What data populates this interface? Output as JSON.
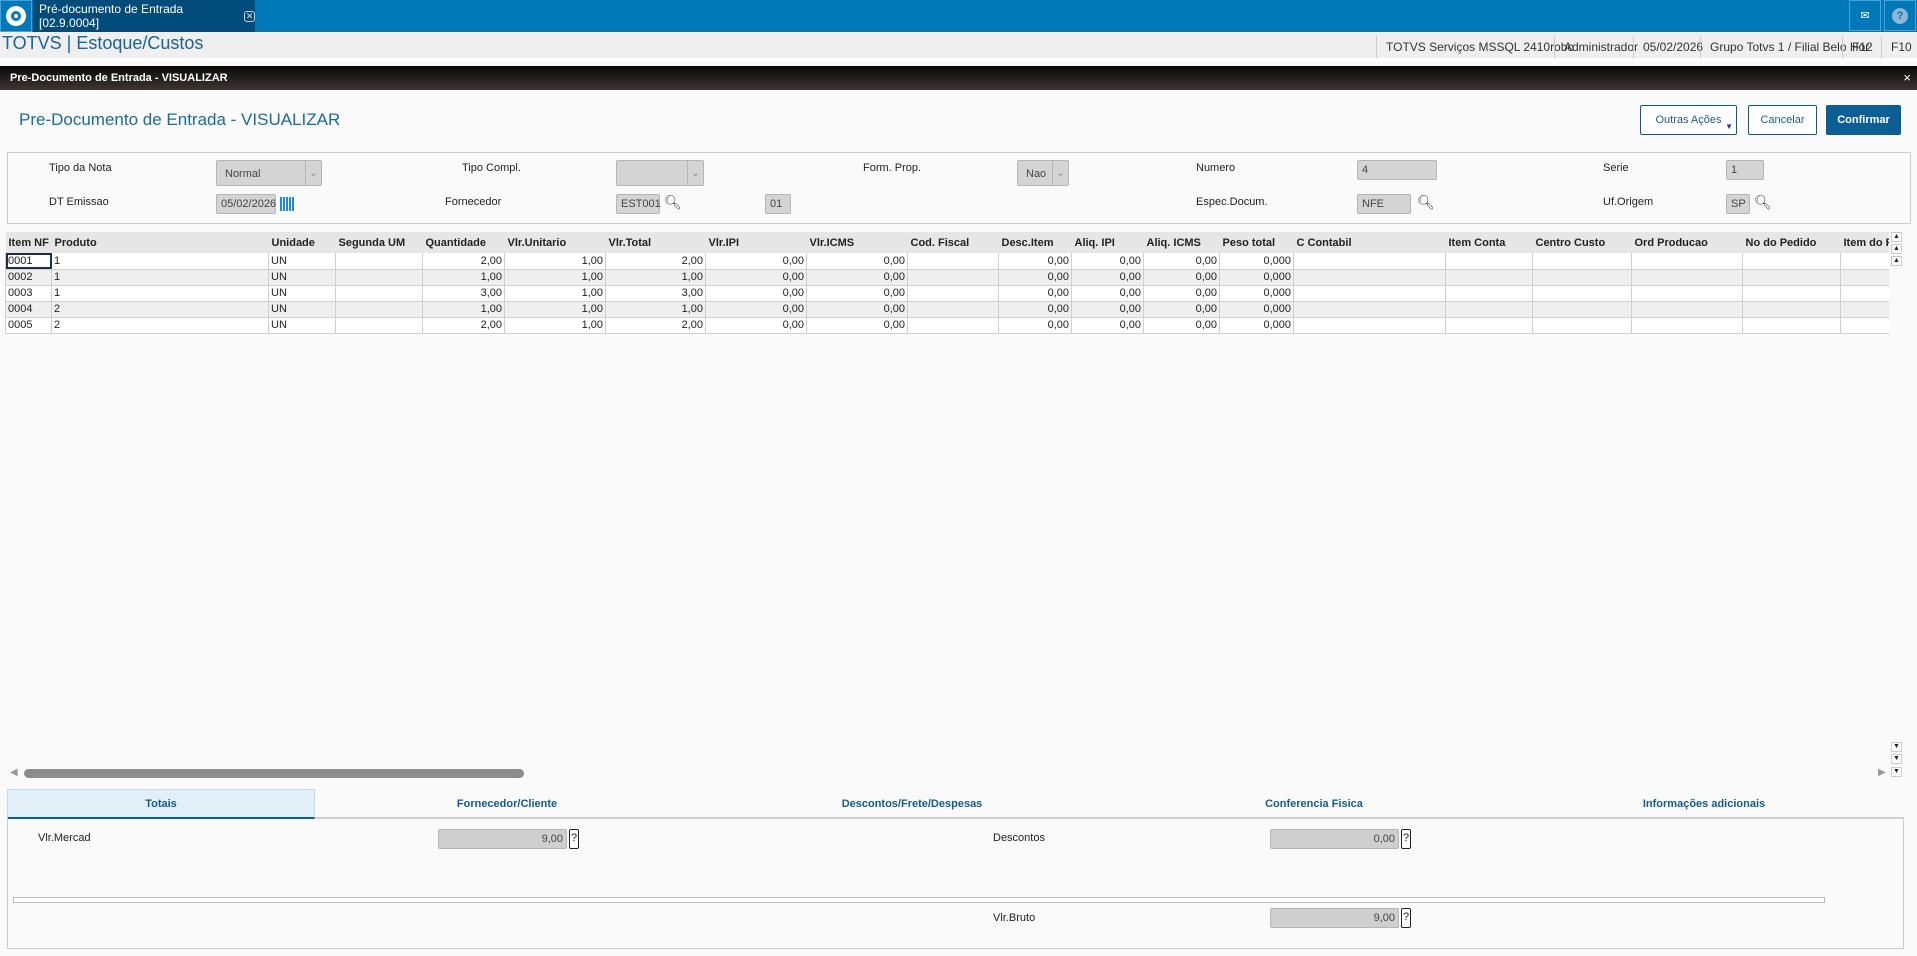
{
  "topbar": {
    "tab_label": "Pré-documento de Entrada [02.9.0004]",
    "tab_close": "✕",
    "mail_icon": "mail-icon",
    "help_icon": "help-icon",
    "accent": "#0179b9"
  },
  "appbar": {
    "title": "TOTVS | Estoque/Custos",
    "status": [
      "TOTVS Serviços MSSQL 2410robo",
      "Administrador",
      "05/02/2026",
      "Grupo Totvs 1 / Filial Belo Hor",
      "F12",
      "F10"
    ]
  },
  "dialog": {
    "bar_title": "Pre-Documento de Entrada - VISUALIZAR",
    "close": "×",
    "page_title": "Pre-Documento de Entrada - VISUALIZAR",
    "buttons": {
      "other": "Outras Ações",
      "cancel": "Cancelar",
      "confirm": "Confirmar"
    }
  },
  "form": {
    "tipo_nota": {
      "label": "Tipo da Nota",
      "value": "Normal"
    },
    "tipo_compl": {
      "label": "Tipo Compl.",
      "value": ""
    },
    "form_prop": {
      "label": "Form. Prop.",
      "value": "Nao"
    },
    "numero": {
      "label": "Numero",
      "value": "4"
    },
    "serie": {
      "label": "Serie",
      "value": "1"
    },
    "dt_emissao": {
      "label": "DT Emissao",
      "value": "05/02/2026"
    },
    "fornecedor": {
      "label": "Fornecedor",
      "value": "EST001",
      "loja": "01"
    },
    "espec_docum": {
      "label": "Espec.Docum.",
      "value": "NFE"
    },
    "uf_origem": {
      "label": "Uf.Origem",
      "value": "SP"
    }
  },
  "grid": {
    "columns": [
      "Item NF",
      "Produto",
      "Unidade",
      "Segunda UM",
      "Quantidade",
      "Vlr.Unitario",
      "Vlr.Total",
      "Vlr.IPI",
      "Vlr.ICMS",
      "Cod. Fiscal",
      "Desc.Item",
      "Aliq. IPI",
      "Aliq. ICMS",
      "Peso total",
      "C Contabil",
      "Item Conta",
      "Centro Custo",
      "Ord Producao",
      "No do Pedido",
      "Item do Pedido"
    ],
    "rows": [
      [
        "0001",
        "1",
        "UN",
        "",
        "2,00",
        "1,00",
        "2,00",
        "0,00",
        "0,00",
        "",
        "0,00",
        "0,00",
        "0,00",
        "0,000",
        "",
        "",
        "",
        "",
        "",
        ""
      ],
      [
        "0002",
        "1",
        "UN",
        "",
        "1,00",
        "1,00",
        "1,00",
        "0,00",
        "0,00",
        "",
        "0,00",
        "0,00",
        "0,00",
        "0,000",
        "",
        "",
        "",
        "",
        "",
        ""
      ],
      [
        "0003",
        "1",
        "UN",
        "",
        "3,00",
        "1,00",
        "3,00",
        "0,00",
        "0,00",
        "",
        "0,00",
        "0,00",
        "0,00",
        "0,000",
        "",
        "",
        "",
        "",
        "",
        ""
      ],
      [
        "0004",
        "2",
        "UN",
        "",
        "1,00",
        "1,00",
        "1,00",
        "0,00",
        "0,00",
        "",
        "0,00",
        "0,00",
        "0,00",
        "0,000",
        "",
        "",
        "",
        "",
        "",
        ""
      ],
      [
        "0005",
        "2",
        "UN",
        "",
        "2,00",
        "1,00",
        "2,00",
        "0,00",
        "0,00",
        "",
        "0,00",
        "0,00",
        "0,00",
        "0,000",
        "",
        "",
        "",
        "",
        "",
        ""
      ]
    ]
  },
  "tabs": [
    "Totais",
    "Fornecedor/Cliente",
    "Descontos/Frete/Despesas",
    "Conferencia Fisica",
    "Informações adicionais"
  ],
  "totais": {
    "vlr_mercad": {
      "label": "Vlr.Mercad",
      "value": "9,00"
    },
    "descontos": {
      "label": "Descontos",
      "value": "0,00"
    },
    "vlr_bruto": {
      "label": "Vlr.Bruto",
      "value": "9,00"
    },
    "help": "?"
  }
}
